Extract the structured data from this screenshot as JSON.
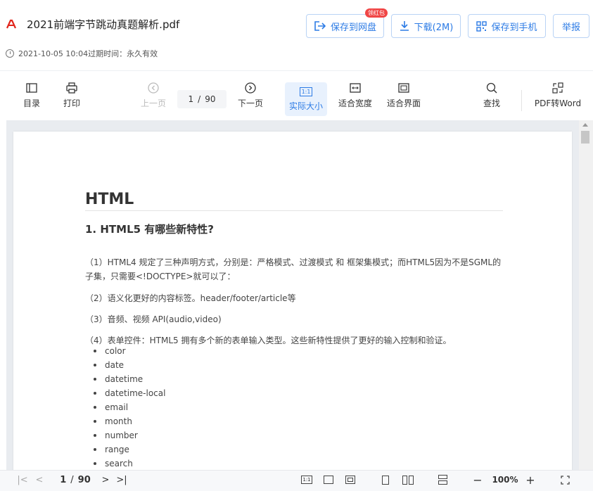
{
  "header": {
    "file_name": "2021前端字节跳动真题解析.pdf",
    "date": "2021-10-05 10:04",
    "expire_label": "过期时间：永久有效",
    "buttons": {
      "save_to_cloud": "保存到网盘",
      "badge": "领红包",
      "download": "下载(2M)",
      "save_to_phone": "保存到手机",
      "report": "举报"
    }
  },
  "toolbar": {
    "toc": "目录",
    "print": "打印",
    "prev_page": "上一页",
    "page_current": "1",
    "page_sep": "/",
    "page_total": "90",
    "next_page": "下一页",
    "actual_size": "实际大小",
    "actual_size_icon": "1:1",
    "fit_width": "适合宽度",
    "fit_page": "适合界面",
    "search": "查找",
    "pdf_to_word": "PDF转Word"
  },
  "document": {
    "h1": "HTML",
    "h2": "1. HTML5 有哪些新特性?",
    "p1": "（1）HTML4 规定了三种声明方式，分别是：严格模式、过渡模式 和 框架集模式；而HTML5因为不是SGML的子集，只需要<!DOCTYPE>就可以了：",
    "p2": "（2）语义化更好的内容标签。header/footer/article等",
    "p3": "（3）音频、视频 API(audio,video)",
    "p4": "（4）表单控件：HTML5 拥有多个新的表单输入类型。这些新特性提供了更好的输入控制和验证。",
    "list": [
      "color",
      "date",
      "datetime",
      "datetime-local",
      "email",
      "month",
      "number",
      "range",
      "search"
    ]
  },
  "bottom_bar": {
    "page_current": "1",
    "page_sep": "/",
    "page_total": "90",
    "actual_size_icon": "1:1",
    "zoom": "100%",
    "minus": "−",
    "plus": "+"
  },
  "colors": {
    "accent": "#2c7be5",
    "pdf_red": "#e1251b",
    "badge": "#f04646"
  }
}
